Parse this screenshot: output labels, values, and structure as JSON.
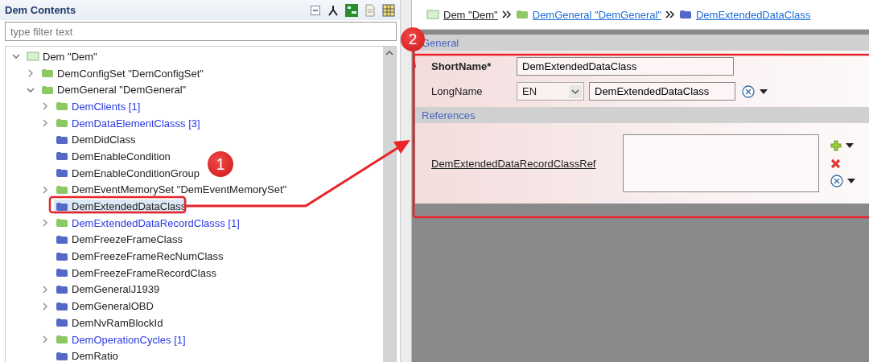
{
  "outline": {
    "title": "Dem Contents",
    "filter": {
      "placeholder": "type filter text"
    },
    "tree": [
      {
        "label": "Dem \"Dem\"",
        "kind": "module",
        "expandable": true,
        "expanded": true,
        "linked": false,
        "selected": false,
        "children": [
          {
            "label": "DemConfigSet \"DemConfigSet\"",
            "kind": "group",
            "expandable": true,
            "expanded": false,
            "linked": false,
            "selected": false
          },
          {
            "label": "DemGeneral \"DemGeneral\"",
            "kind": "group",
            "expandable": true,
            "expanded": true,
            "linked": false,
            "selected": false,
            "children": [
              {
                "label": "DemClients [1]",
                "kind": "group",
                "expandable": true,
                "expanded": false,
                "linked": true,
                "selected": false
              },
              {
                "label": "DemDataElementClasss [3]",
                "kind": "group",
                "expandable": true,
                "expanded": false,
                "linked": true,
                "selected": false
              },
              {
                "label": "DemDidClass",
                "kind": "item",
                "expandable": false,
                "linked": false,
                "selected": false
              },
              {
                "label": "DemEnableCondition",
                "kind": "item",
                "expandable": false,
                "linked": false,
                "selected": false
              },
              {
                "label": "DemEnableConditionGroup",
                "kind": "item",
                "expandable": false,
                "linked": false,
                "selected": false
              },
              {
                "label": "DemEventMemorySet \"DemEventMemorySet\"",
                "kind": "group",
                "expandable": true,
                "expanded": false,
                "linked": false,
                "selected": false
              },
              {
                "label": "DemExtendedDataClass",
                "kind": "item",
                "expandable": false,
                "linked": false,
                "selected": true
              },
              {
                "label": "DemExtendedDataRecordClasss [1]",
                "kind": "group",
                "expandable": true,
                "expanded": false,
                "linked": true,
                "selected": false
              },
              {
                "label": "DemFreezeFrameClass",
                "kind": "item",
                "expandable": false,
                "linked": false,
                "selected": false
              },
              {
                "label": "DemFreezeFrameRecNumClass",
                "kind": "item",
                "expandable": false,
                "linked": false,
                "selected": false
              },
              {
                "label": "DemFreezeFrameRecordClass",
                "kind": "item",
                "expandable": false,
                "linked": false,
                "selected": false
              },
              {
                "label": "DemGeneralJ1939",
                "kind": "item",
                "expandable": true,
                "expanded": false,
                "linked": false,
                "selected": false
              },
              {
                "label": "DemGeneralOBD",
                "kind": "item",
                "expandable": true,
                "expanded": false,
                "linked": false,
                "selected": false
              },
              {
                "label": "DemNvRamBlockId",
                "kind": "item",
                "expandable": false,
                "linked": false,
                "selected": false
              },
              {
                "label": "DemOperationCycles [1]",
                "kind": "group",
                "expandable": true,
                "expanded": false,
                "linked": true,
                "selected": false
              },
              {
                "label": "DemRatio",
                "kind": "item",
                "expandable": false,
                "linked": false,
                "selected": false
              }
            ]
          }
        ]
      }
    ]
  },
  "editor": {
    "breadcrumb": [
      {
        "label": "Dem \"Dem\"",
        "kind": "module"
      },
      {
        "label": "DemGeneral \"DemGeneral\"",
        "kind": "group"
      },
      {
        "label": "DemExtendedDataClass",
        "kind": "item"
      }
    ],
    "general": {
      "title": "General",
      "short_name": {
        "label": "ShortName*",
        "value": "DemExtendedDataClass"
      },
      "long_name": {
        "label": "LongName",
        "language": "EN",
        "value": "DemExtendedDataClass"
      }
    },
    "references": {
      "title": "References",
      "reference": {
        "label": "DemExtendedDataRecordClassRef"
      }
    }
  },
  "annotations": [
    {
      "label": "1"
    },
    {
      "label": "2"
    }
  ]
}
